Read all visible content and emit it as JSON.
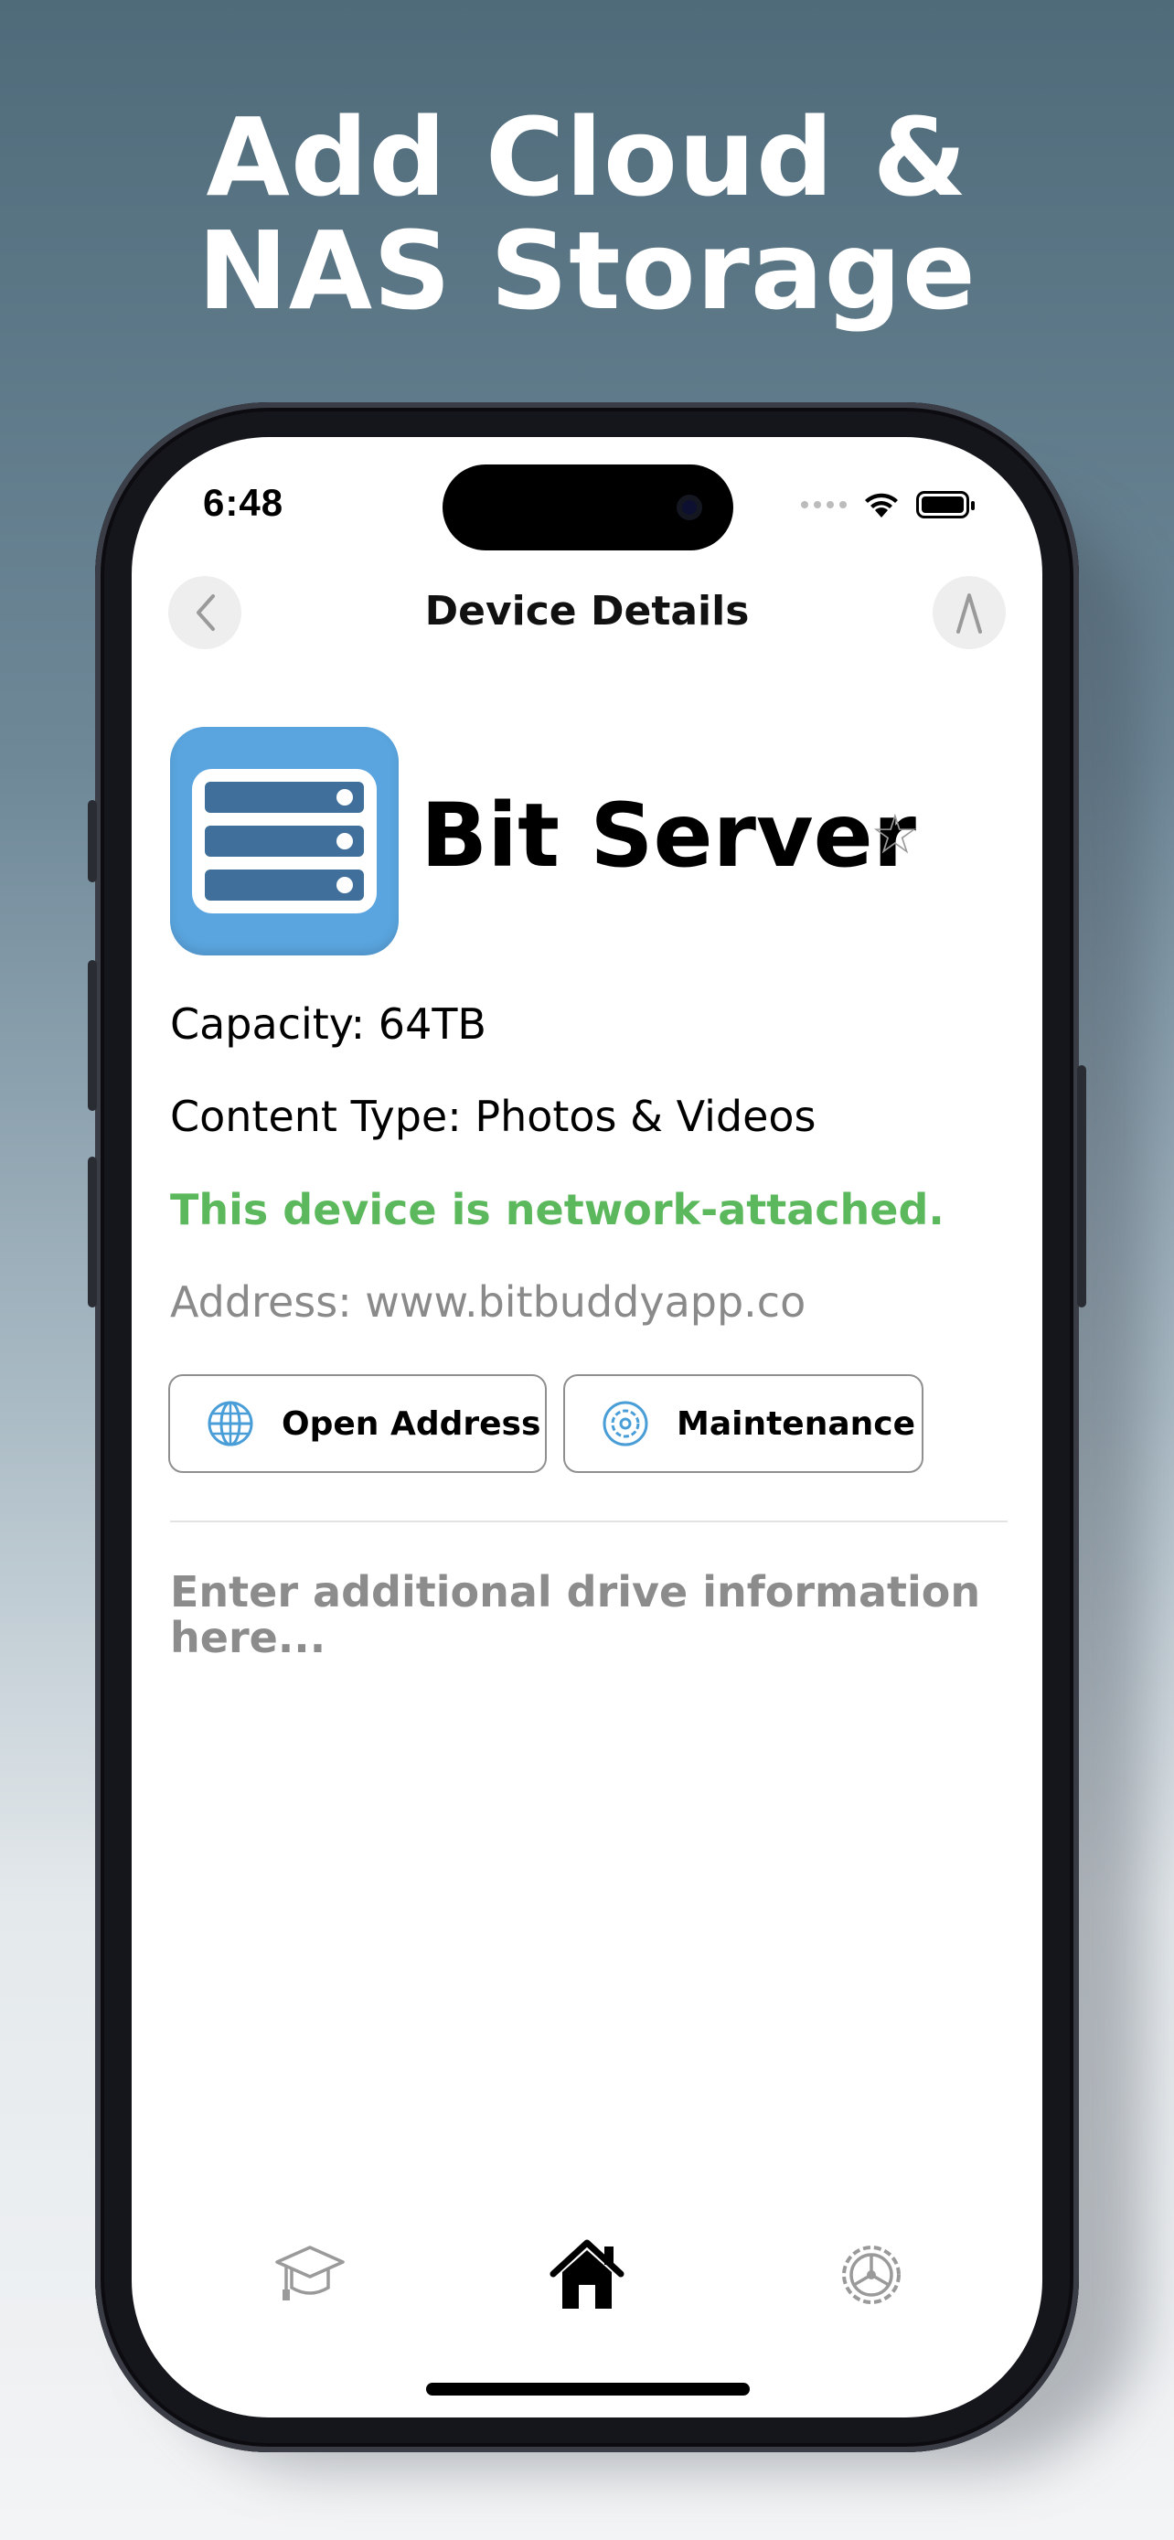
{
  "headline": {
    "line1": "Add Cloud &",
    "line2": "NAS Storage"
  },
  "status_bar": {
    "time": "6:48"
  },
  "nav": {
    "title": "Device Details",
    "back_icon": "chevron-left-icon",
    "action_icon": "compass-icon"
  },
  "device": {
    "name": "Bit Server",
    "favorite_icon": "star-outline-icon",
    "capacity": "Capacity: 64TB",
    "content_type": "Content Type: Photos & Videos",
    "network_status": "This device is network-attached.",
    "address": "Address: www.bitbuddyapp.co"
  },
  "buttons": {
    "open_address": "Open Address",
    "maintenance": "Maintenance"
  },
  "notes": {
    "placeholder": "Enter additional drive information here..."
  },
  "tab_bar": {
    "items": [
      "learn-icon",
      "home-icon",
      "settings-icon"
    ]
  },
  "colors": {
    "accent_blue": "#4a9ed8",
    "network_green": "#5cb85c",
    "text_gray": "#8a8a8a"
  }
}
